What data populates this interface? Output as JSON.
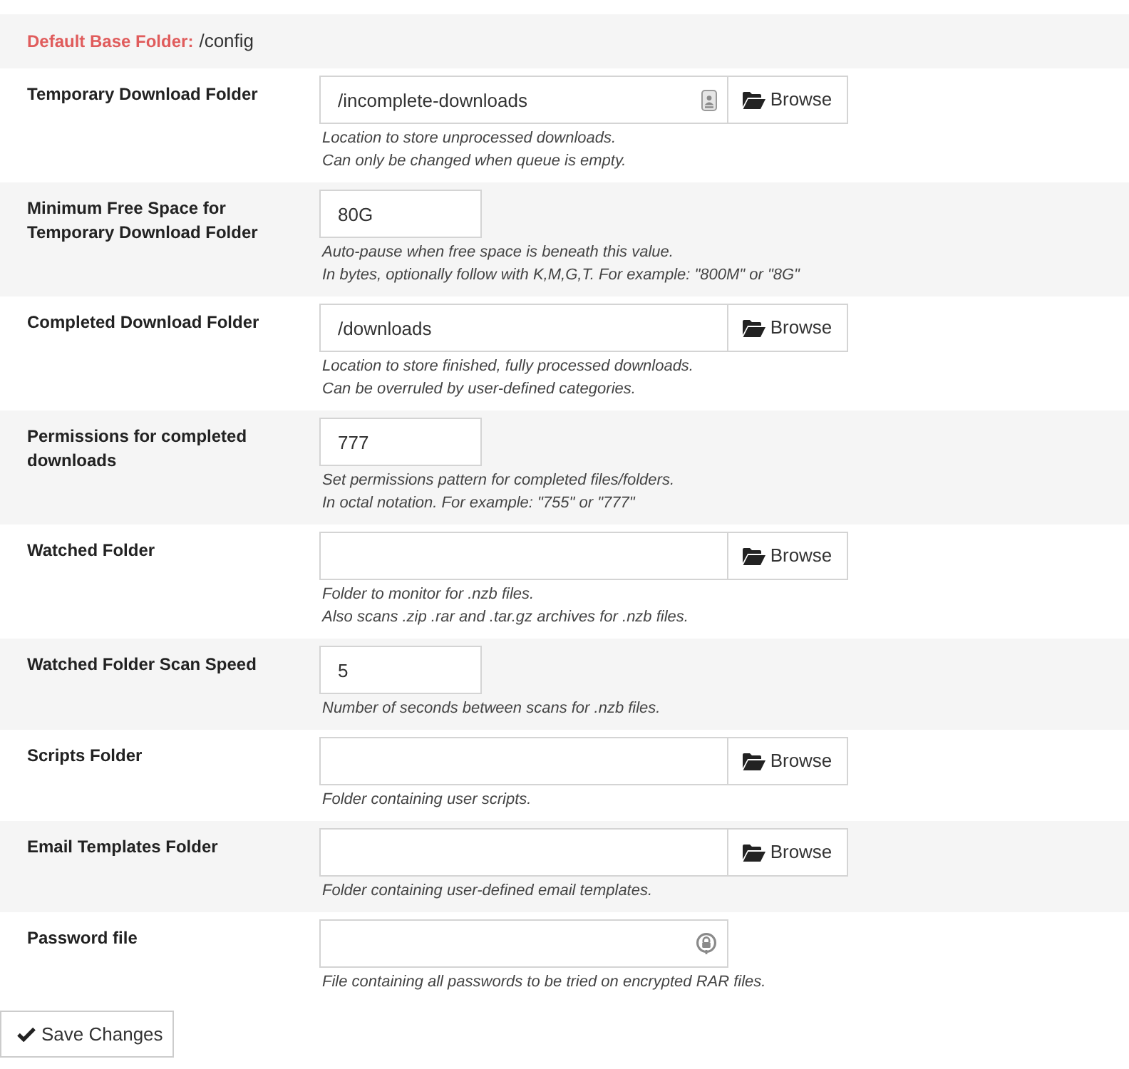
{
  "header": {
    "label": "Default Base Folder:",
    "value": "/config"
  },
  "settings": [
    {
      "kind": "folder",
      "label": "Temporary Download Folder",
      "value": "/incomplete-downloads",
      "field_icon": {
        "kind": "card"
      },
      "button": "Browse",
      "help": [
        "Location to store unprocessed downloads.",
        "Can only be changed when queue is empty."
      ]
    },
    {
      "kind": "short",
      "label": "Minimum Free Space for Temporary Download Folder",
      "value": "80G",
      "help": [
        "Auto-pause when free space is beneath this value.",
        "In bytes, optionally follow with K,M,G,T. For example: \"800M\" or \"8G\""
      ]
    },
    {
      "kind": "folder",
      "label": "Completed Download Folder",
      "value": "/downloads",
      "button": "Browse",
      "help": [
        "Location to store finished, fully processed downloads.",
        "Can be overruled by user-defined categories."
      ]
    },
    {
      "kind": "short",
      "label": "Permissions for completed downloads",
      "value": "777",
      "help": [
        "Set permissions pattern for completed files/folders.",
        "In octal notation. For example: \"755\" or \"777\""
      ]
    },
    {
      "kind": "folder",
      "label": "Watched Folder",
      "button": "Browse",
      "help": [
        "Folder to monitor for .nzb files.",
        "Also scans .zip .rar and .tar.gz archives for .nzb files."
      ]
    },
    {
      "kind": "short",
      "label": "Watched Folder Scan Speed",
      "value": "5",
      "help": [
        "Number of seconds between scans for .nzb files."
      ]
    },
    {
      "kind": "folder",
      "label": "Scripts Folder",
      "button": "Browse",
      "help": [
        "Folder containing user scripts."
      ]
    },
    {
      "kind": "folder",
      "label": "Email Templates Folder",
      "button": "Browse",
      "help": [
        "Folder containing user-defined email templates."
      ]
    },
    {
      "kind": "file",
      "label": "Password file",
      "field_icon": {
        "kind": "lock"
      },
      "help": [
        "File containing all passwords to be tried on encrypted RAR files."
      ]
    }
  ],
  "save_button": {
    "label": "Save Changes"
  }
}
